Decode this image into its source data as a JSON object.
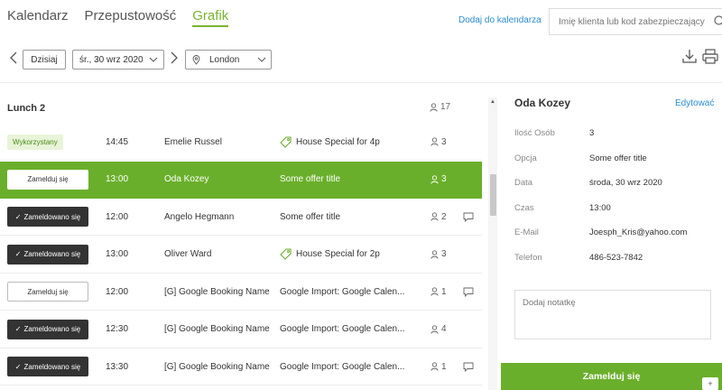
{
  "nav": {
    "tabs": [
      {
        "label": "Kalendarz"
      },
      {
        "label": "Przepustowość"
      },
      {
        "label": "Grafik"
      }
    ],
    "active_tab": "Grafik",
    "add_to_calendar": "Dodaj do kalendarza",
    "search_placeholder": "Imię klienta lub kod zabezpieczający"
  },
  "toolbar": {
    "today_label": "Dzisiaj",
    "date_value": "śr., 30 wrz 2020",
    "location_value": "London"
  },
  "list": {
    "group_title": "Lunch 2",
    "group_count": "17",
    "rows": [
      {
        "status": "Wykorzystany",
        "status_type": "used",
        "time": "14:45",
        "name": "Emelie Russel",
        "offer": "House Special for 4p",
        "offer_tag": true,
        "guests": "3",
        "comment": false,
        "selected": false
      },
      {
        "status": "Zamelduj się",
        "status_type": "checkin",
        "time": "13:00",
        "name": "Oda Kozey",
        "offer": "Some offer title",
        "offer_tag": false,
        "guests": "3",
        "comment": false,
        "selected": true
      },
      {
        "status": "Zameldowano się",
        "status_type": "checked",
        "time": "12:00",
        "name": "Angelo Hegmann",
        "offer": "Some offer title",
        "offer_tag": false,
        "guests": "2",
        "comment": true,
        "selected": false
      },
      {
        "status": "Zameldowano się",
        "status_type": "checked",
        "time": "13:00",
        "name": "Oliver Ward",
        "offer": "House Special for 2p",
        "offer_tag": true,
        "guests": "3",
        "comment": false,
        "selected": false
      },
      {
        "status": "Zamelduj się",
        "status_type": "checkin",
        "time": "12:00",
        "name": "[G] Google Booking Name",
        "offer": "Google Import: Google Calen...",
        "offer_tag": false,
        "guests": "1",
        "comment": true,
        "selected": false
      },
      {
        "status": "Zameldowano się",
        "status_type": "checked",
        "time": "12:30",
        "name": "[G] Google Booking Name",
        "offer": "Google Import: Google Calen...",
        "offer_tag": false,
        "guests": "4",
        "comment": false,
        "selected": false
      },
      {
        "status": "Zameldowano się",
        "status_type": "checked",
        "time": "13:30",
        "name": "[G] Google Booking Name",
        "offer": "Google Import: Google Calen...",
        "offer_tag": false,
        "guests": "1",
        "comment": true,
        "selected": false
      }
    ]
  },
  "detail": {
    "name": "Oda Kozey",
    "edit_label": "Edytować",
    "fields": [
      {
        "label": "Ilość Osób",
        "value": "3"
      },
      {
        "label": "Opcja",
        "value": "Some offer title"
      },
      {
        "label": "Data",
        "value": "środa, 30 wrz 2020"
      },
      {
        "label": "Czas",
        "value": "13:00"
      },
      {
        "label": "E-Mail",
        "value": "Joesph_Kris@yahoo.com"
      },
      {
        "label": "Telefon",
        "value": "486-523-7842"
      }
    ],
    "note_placeholder": "Dodaj notatkę",
    "checkin_label": "Zamelduj się"
  },
  "colors": {
    "accent": "#6aaf2b",
    "link": "#2a8cd1",
    "dark_button": "#333333"
  }
}
